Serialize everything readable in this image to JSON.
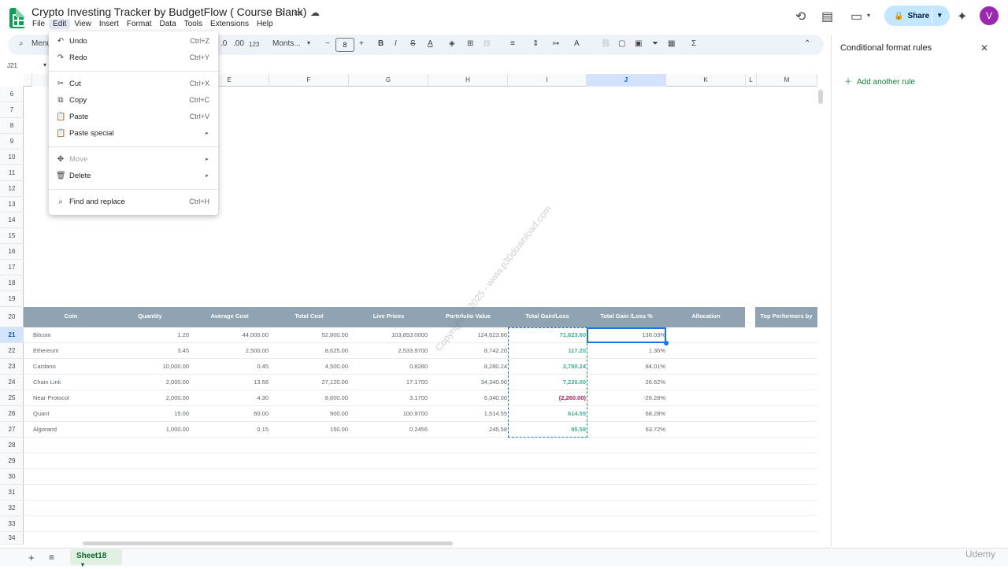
{
  "app": {
    "doc_title": "Crypto Investing Tracker by BudgetFlow ( Course Blank)",
    "menus": [
      "File",
      "Edit",
      "View",
      "Insert",
      "Format",
      "Data",
      "Tools",
      "Extensions",
      "Help"
    ],
    "share_label": "Share",
    "avatar_letter": "V"
  },
  "toolbar": {
    "search_placeholder": "Menus",
    "format_123": "123",
    "dec_decrease": ".0",
    "dec_increase": ".00",
    "font_name": "Monts...",
    "font_size": "8"
  },
  "namebox": "J21",
  "columns": [
    "E",
    "F",
    "G",
    "H",
    "I",
    "J",
    "K",
    "L",
    "M"
  ],
  "rows": [
    "6",
    "7",
    "8",
    "9",
    "10",
    "11",
    "12",
    "13",
    "14",
    "15",
    "16",
    "17",
    "18",
    "19",
    "20",
    "21",
    "22",
    "23",
    "24",
    "25",
    "26",
    "27",
    "28",
    "29",
    "30",
    "31",
    "32",
    "33",
    "34"
  ],
  "edit_menu": [
    {
      "icon": "undo-icon",
      "glyph": "↶",
      "label": "Undo",
      "shortcut": "Ctrl+Z"
    },
    {
      "icon": "redo-icon",
      "glyph": "↷",
      "label": "Redo",
      "shortcut": "Ctrl+Y"
    },
    {
      "icon": "cut-icon",
      "glyph": "✂",
      "label": "Cut",
      "shortcut": "Ctrl+X"
    },
    {
      "icon": "copy-icon",
      "glyph": "⧉",
      "label": "Copy",
      "shortcut": "Ctrl+C"
    },
    {
      "icon": "paste-icon",
      "glyph": "📋",
      "label": "Paste",
      "shortcut": "Ctrl+V"
    },
    {
      "icon": "paste-special-icon",
      "glyph": "📋",
      "label": "Paste special",
      "shortcut": "►"
    },
    {
      "icon": "move-icon",
      "glyph": "✥",
      "label": "Move",
      "shortcut": "►"
    },
    {
      "icon": "delete-icon",
      "glyph": "🗑",
      "label": "Delete",
      "shortcut": "►"
    },
    {
      "icon": "find-replace-icon",
      "glyph": "⌕",
      "label": "Find and replace",
      "shortcut": "Ctrl+H"
    }
  ],
  "table": {
    "headers": [
      "Coin",
      "Quantity",
      "Average Cost",
      "Total Cost",
      "Live Prices",
      "Portofolio Value",
      "Total Gain/Loss",
      "Total Gain /Loss %",
      "Allocation"
    ],
    "side_header": "Top Performers by",
    "rows": [
      [
        "Bitcoin",
        "1.20",
        "44,000.00",
        "52,800.00",
        "103,853.0000",
        "124,623.60",
        "71,823.60",
        "136.03%"
      ],
      [
        "Ethereum",
        "3.45",
        "2,500.00",
        "8,625.00",
        "2,533.9700",
        "8,742.20",
        "117.20",
        "1.36%"
      ],
      [
        "Cardano",
        "10,000.00",
        "0.45",
        "4,500.00",
        "0.8280",
        "8,280.24",
        "3,780.24",
        "84.01%"
      ],
      [
        "Chain Link",
        "2,000.00",
        "13.56",
        "27,120.00",
        "17.1700",
        "34,340.00",
        "7,220.00",
        "26.62%"
      ],
      [
        "Near Protocol",
        "2,000.00",
        "4.30",
        "8,600.00",
        "3.1700",
        "6,340.00",
        "(2,260.00)",
        "-26.28%"
      ],
      [
        "Quant",
        "15.00",
        "60.00",
        "900.00",
        "100.9700",
        "1,514.55",
        "614.55",
        "68.28%"
      ],
      [
        "Algorand",
        "1,000.00",
        "0.15",
        "150.00",
        "0.2456",
        "245.58",
        "95.58",
        "63.72%"
      ]
    ],
    "gain_colors": {
      "positive": "#3bb08f",
      "negative": "#c2185b"
    }
  },
  "panel": {
    "title": "Conditional format rules",
    "add_rule": "Add another rule"
  },
  "sheet_tab": "Sheet18",
  "watermark": "Copyright © 2025 - www.p30download.com",
  "brand_mark": "Udemy"
}
